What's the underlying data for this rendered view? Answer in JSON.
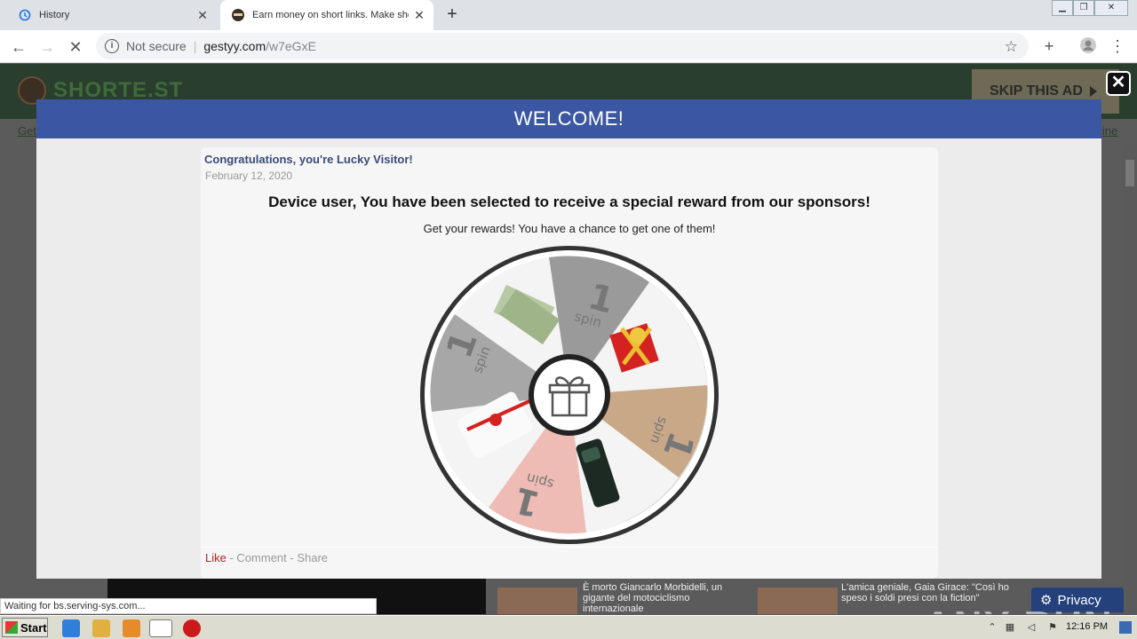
{
  "browser": {
    "tabs": [
      {
        "label": "History",
        "icon": "history-icon"
      },
      {
        "label": "Earn money on short links. Make short links and earn",
        "icon": "shortest-favicon"
      }
    ],
    "new_tab_label": "+",
    "address": {
      "security_label": "Not secure",
      "host": "gestyy.com",
      "path": "/w7eGxE"
    }
  },
  "site": {
    "logo_text": "SHORTE.ST",
    "skip_label": "SKIP THIS AD",
    "left_link": "Get",
    "right_link": "line"
  },
  "modal": {
    "title": "WELCOME!",
    "post_title": "Congratulations, you're Lucky Visitor!",
    "post_date": "February 12, 2020",
    "headline": "Device user, You have been selected to receive a special reward from our sponsors!",
    "subline": "Get your rewards! You have a chance to get one of them!",
    "wheel_segments": [
      {
        "label": "1",
        "sub": "spin"
      },
      {
        "label": "1",
        "sub": "spin"
      },
      {
        "label": "1",
        "sub": "spin"
      },
      {
        "label": "1",
        "sub": "spin"
      }
    ],
    "actions": {
      "like": "Like",
      "sep": " - ",
      "comment": "Comment",
      "share": "Share"
    }
  },
  "news": [
    {
      "text": "È morto Giancarlo Morbidelli, un gigante del motociclismo internazionale"
    },
    {
      "text": "L'amica geniale, Gaia Girace: \"Così ho speso i soldi presi con la fiction\""
    }
  ],
  "privacy_label": "Privacy",
  "watermark": "ANY RUN",
  "status_text": "Waiting for bs.serving-sys.com...",
  "taskbar": {
    "start_label": "Start",
    "clock": "12:16 PM"
  }
}
